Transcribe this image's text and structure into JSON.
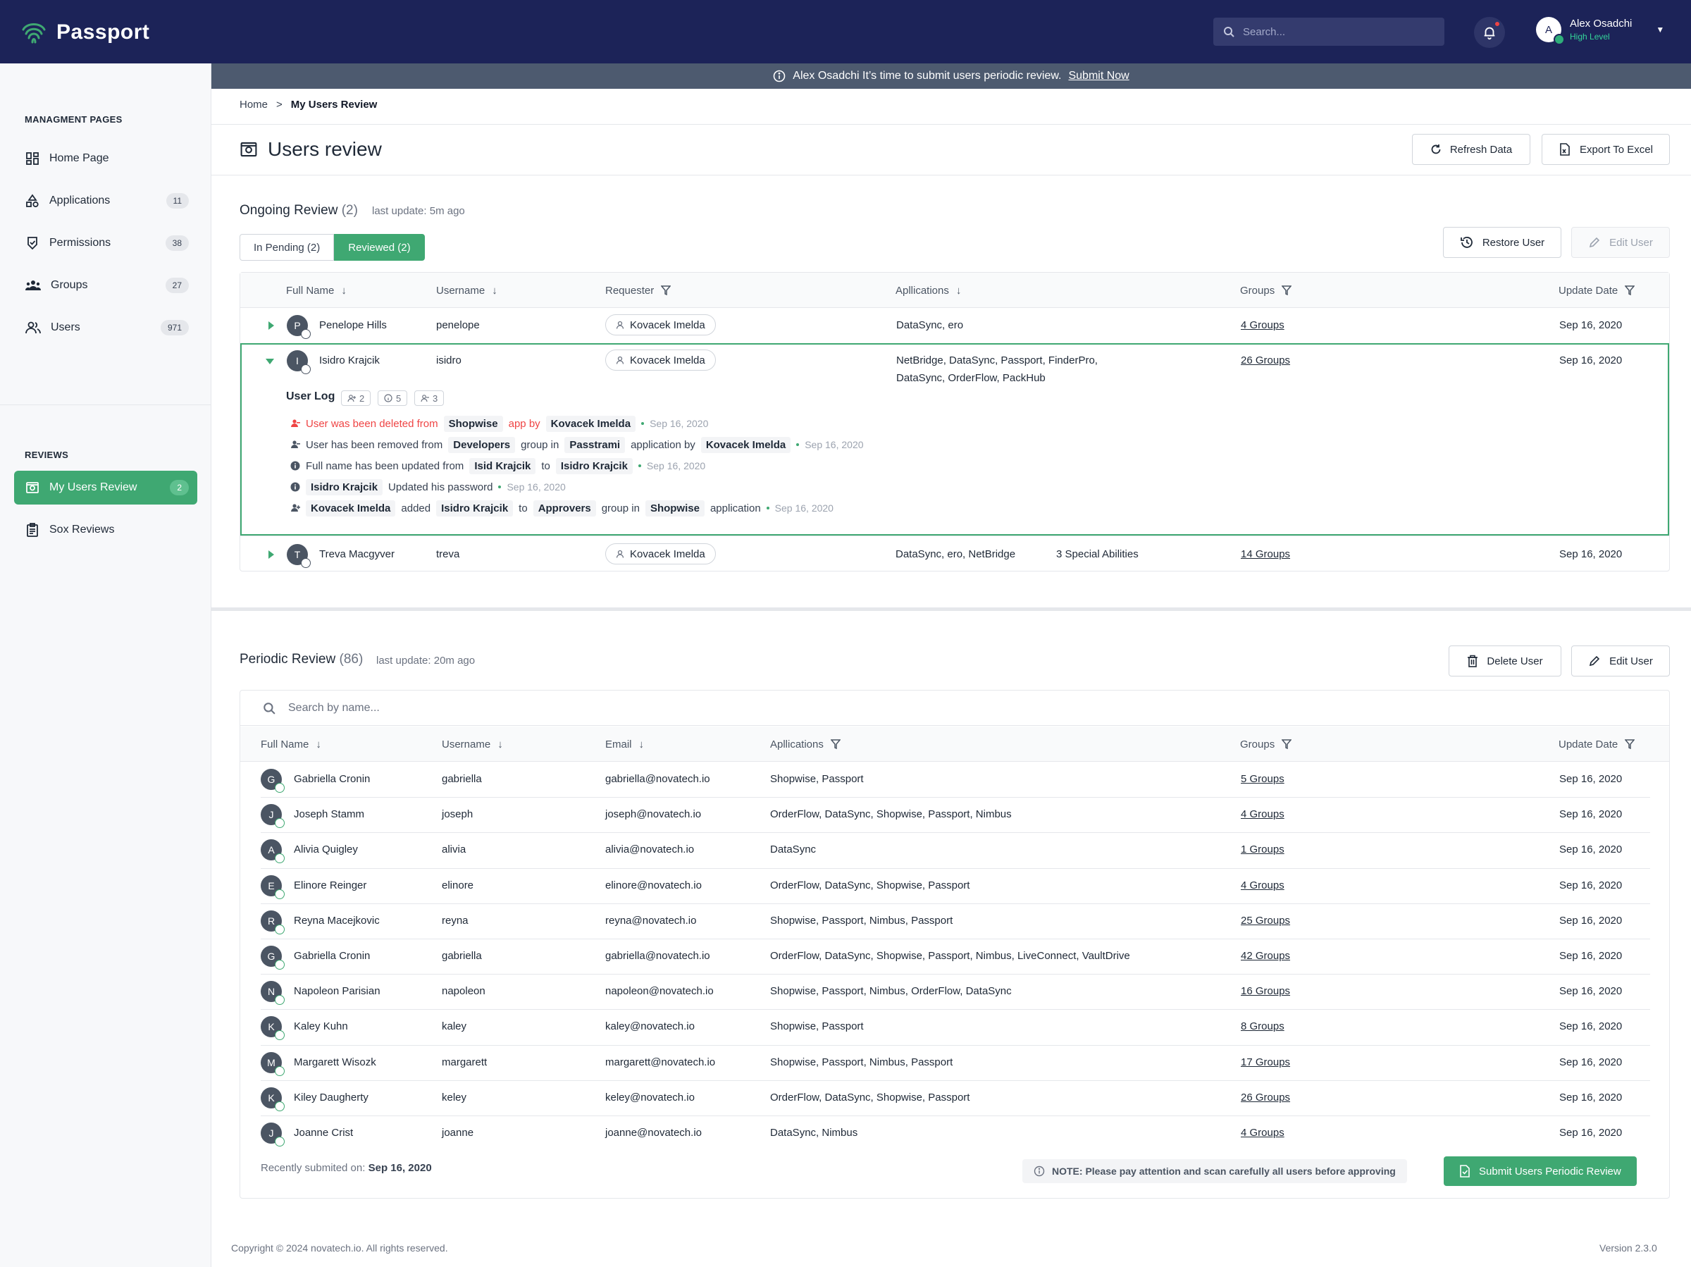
{
  "app": {
    "name": "Passport"
  },
  "topbar": {
    "search_placeholder": "Search...",
    "user": {
      "initial": "A",
      "name": "Alex Osadchi",
      "role": "High Level"
    }
  },
  "sidebar": {
    "section_manage": "MANAGMENT PAGES",
    "manage_items": [
      {
        "label": "Home Page",
        "icon": "dashboard-icon",
        "badge": ""
      },
      {
        "label": "Applications",
        "icon": "shapes-icon",
        "badge": "11"
      },
      {
        "label": "Permissions",
        "icon": "shield-check-icon",
        "badge": "38"
      },
      {
        "label": "Groups",
        "icon": "group-icon",
        "badge": "27"
      },
      {
        "label": "Users",
        "icon": "users-icon",
        "badge": "971"
      }
    ],
    "section_reviews": "REVIEWS",
    "review_items": [
      {
        "label": "My Users Review",
        "icon": "review-icon",
        "badge": "2",
        "active": true
      },
      {
        "label": "Sox Reviews",
        "icon": "clipboard-icon",
        "badge": ""
      }
    ]
  },
  "announcement": {
    "text": "Alex Osadchi It’s time to submit users periodic review.",
    "link": "Submit Now"
  },
  "breadcrumb": {
    "home": "Home",
    "sep": ">",
    "current": "My Users Review"
  },
  "page": {
    "title": "Users review",
    "refresh_label": "Refresh Data",
    "export_label": "Export To Excel"
  },
  "ongoing": {
    "title": "Ongoing Review",
    "count": "(2)",
    "last_update": "last update: 5m ago",
    "tab_pending": "In Pending (2)",
    "tab_reviewed": "Reviewed (2)",
    "restore_label": "Restore User",
    "edit_label": "Edit User",
    "headers": [
      "Full Name",
      "Username",
      "Requester",
      "Apllications",
      "Groups",
      "Update Date"
    ],
    "rows": [
      {
        "initial": "P",
        "name": "Penelope Hills",
        "username": "penelope",
        "requester": "Kovacek Imelda",
        "apps": "DataSync, ero",
        "apps2": "",
        "extra": "",
        "groups": "4 Groups",
        "date": "Sep 16, 2020"
      },
      {
        "initial": "I",
        "name": "Isidro Krajcik",
        "username": "isidro",
        "requester": "Kovacek Imelda",
        "apps": "NetBridge, DataSync, Passport, FinderPro,",
        "apps2": "DataSync, OrderFlow, PackHub",
        "extra": "",
        "groups": "26 Groups",
        "date": "Sep 16, 2020"
      },
      {
        "initial": "T",
        "name": "Treva Macgyver",
        "username": "treva",
        "requester": "Kovacek Imelda",
        "apps": "DataSync, ero, NetBridge",
        "apps2": "",
        "extra": "3 Special Abilities",
        "groups": "14 Groups",
        "date": "Sep 16, 2020"
      }
    ],
    "log": {
      "title": "User Log",
      "chips": [
        "2",
        "5",
        "3"
      ],
      "lines": [
        {
          "t1": "User was been deleted from",
          "tag1": "Shopwise",
          "t2": "app by",
          "tag2": "Kovacek Imelda",
          "date": "Sep 16, 2020"
        },
        {
          "t1": "User has been removed from",
          "tag1": "Developers",
          "t2": "group in",
          "tag2": "Passtrami",
          "t3": "application by",
          "tag3": "Kovacek Imelda",
          "date": "Sep 16, 2020"
        },
        {
          "t1": "Full name has been updated from",
          "tag1": "Isid Krajcik",
          "t2": "to",
          "tag2": "Isidro Krajcik",
          "date": "Sep 16, 2020"
        },
        {
          "tag1": "Isidro Krajcik",
          "t1": "Updated his password",
          "date": "Sep 16, 2020"
        },
        {
          "tag1": "Kovacek Imelda",
          "t1": "added",
          "tag2": "Isidro Krajcik",
          "t2": "to",
          "tag3": "Approvers",
          "t3": "group in",
          "tag4": "Shopwise",
          "t4": "application",
          "date": "Sep 16, 2020"
        }
      ]
    }
  },
  "periodic": {
    "title": "Periodic Review",
    "count": "(86)",
    "last_update": "last update: 20m ago",
    "delete_label": "Delete User",
    "edit_label": "Edit User",
    "search_placeholder": "Search by name...",
    "headers": [
      "Full Name",
      "Username",
      "Email",
      "Apllications",
      "Groups",
      "Update Date"
    ],
    "rows": [
      {
        "initial": "G",
        "name": "Gabriella Cronin",
        "username": "gabriella",
        "email": "gabriella@novatech.io",
        "apps": "Shopwise, Passport",
        "groups": "5 Groups",
        "date": "Sep 16, 2020"
      },
      {
        "initial": "J",
        "name": "Joseph Stamm",
        "username": "joseph",
        "email": "joseph@novatech.io",
        "apps": "OrderFlow, DataSync, Shopwise, Passport, Nimbus",
        "groups": "4 Groups",
        "date": "Sep 16, 2020"
      },
      {
        "initial": "A",
        "name": "Alivia Quigley",
        "username": "alivia",
        "email": "alivia@novatech.io",
        "apps": "DataSync",
        "groups": "1 Groups",
        "date": "Sep 16, 2020"
      },
      {
        "initial": "E",
        "name": "Elinore Reinger",
        "username": "elinore",
        "email": "elinore@novatech.io",
        "apps": "OrderFlow, DataSync, Shopwise, Passport",
        "groups": "4 Groups",
        "date": "Sep 16, 2020"
      },
      {
        "initial": "R",
        "name": "Reyna Macejkovic",
        "username": "reyna",
        "email": "reyna@novatech.io",
        "apps": "Shopwise, Passport, Nimbus, Passport",
        "groups": "25 Groups",
        "date": "Sep 16, 2020"
      },
      {
        "initial": "G",
        "name": "Gabriella Cronin",
        "username": "gabriella",
        "email": "gabriella@novatech.io",
        "apps": "OrderFlow, DataSync, Shopwise, Passport, Nimbus, LiveConnect, VaultDrive",
        "groups": "42 Groups",
        "date": "Sep 16, 2020"
      },
      {
        "initial": "N",
        "name": "Napoleon Parisian",
        "username": "napoleon",
        "email": "napoleon@novatech.io",
        "apps": "Shopwise, Passport, Nimbus, OrderFlow, DataSync",
        "groups": "16 Groups",
        "date": "Sep 16, 2020"
      },
      {
        "initial": "K",
        "name": "Kaley Kuhn",
        "username": "kaley",
        "email": "kaley@novatech.io",
        "apps": "Shopwise, Passport",
        "groups": "8 Groups",
        "date": "Sep 16, 2020"
      },
      {
        "initial": "M",
        "name": "Margarett Wisozk",
        "username": "margarett",
        "email": "margarett@novatech.io",
        "apps": "Shopwise, Passport, Nimbus, Passport",
        "groups": "17 Groups",
        "date": "Sep 16, 2020"
      },
      {
        "initial": "K",
        "name": "Kiley Daugherty",
        "username": "keley",
        "email": "keley@novatech.io",
        "apps": "OrderFlow, DataSync, Shopwise, Passport",
        "groups": "26 Groups",
        "date": "Sep 16, 2020"
      },
      {
        "initial": "J",
        "name": "Joanne Crist",
        "username": "joanne",
        "email": "joanne@novatech.io",
        "apps": "DataSync, Nimbus",
        "groups": "4 Groups",
        "date": "Sep 16, 2020"
      }
    ],
    "recent_label": "Recently submited on:",
    "recent_date": "Sep 16, 2020",
    "note": "NOTE: Please pay attention and scan carefully all users before approving",
    "submit_label": "Submit Users Periodic Review"
  },
  "footer": {
    "copyright": "Copyright © 2024 novatech.io. All rights reserved.",
    "version": "Version 2.3.0"
  },
  "colors": {
    "navy": "#1c2358",
    "accent": "#3fa872",
    "banner": "#4d5a6f",
    "danger": "#ef4444"
  }
}
